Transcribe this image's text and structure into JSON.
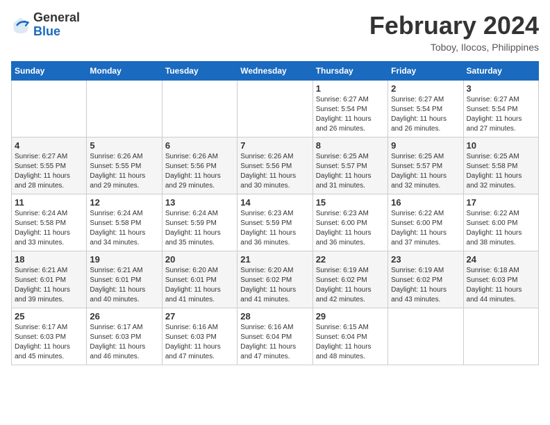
{
  "header": {
    "logo_general": "General",
    "logo_blue": "Blue",
    "title": "February 2024",
    "subtitle": "Toboy, Ilocos, Philippines"
  },
  "weekdays": [
    "Sunday",
    "Monday",
    "Tuesday",
    "Wednesday",
    "Thursday",
    "Friday",
    "Saturday"
  ],
  "weeks": [
    [
      {
        "day": "",
        "info": ""
      },
      {
        "day": "",
        "info": ""
      },
      {
        "day": "",
        "info": ""
      },
      {
        "day": "",
        "info": ""
      },
      {
        "day": "1",
        "info": "Sunrise: 6:27 AM\nSunset: 5:54 PM\nDaylight: 11 hours\nand 26 minutes."
      },
      {
        "day": "2",
        "info": "Sunrise: 6:27 AM\nSunset: 5:54 PM\nDaylight: 11 hours\nand 26 minutes."
      },
      {
        "day": "3",
        "info": "Sunrise: 6:27 AM\nSunset: 5:54 PM\nDaylight: 11 hours\nand 27 minutes."
      }
    ],
    [
      {
        "day": "4",
        "info": "Sunrise: 6:27 AM\nSunset: 5:55 PM\nDaylight: 11 hours\nand 28 minutes."
      },
      {
        "day": "5",
        "info": "Sunrise: 6:26 AM\nSunset: 5:55 PM\nDaylight: 11 hours\nand 29 minutes."
      },
      {
        "day": "6",
        "info": "Sunrise: 6:26 AM\nSunset: 5:56 PM\nDaylight: 11 hours\nand 29 minutes."
      },
      {
        "day": "7",
        "info": "Sunrise: 6:26 AM\nSunset: 5:56 PM\nDaylight: 11 hours\nand 30 minutes."
      },
      {
        "day": "8",
        "info": "Sunrise: 6:25 AM\nSunset: 5:57 PM\nDaylight: 11 hours\nand 31 minutes."
      },
      {
        "day": "9",
        "info": "Sunrise: 6:25 AM\nSunset: 5:57 PM\nDaylight: 11 hours\nand 32 minutes."
      },
      {
        "day": "10",
        "info": "Sunrise: 6:25 AM\nSunset: 5:58 PM\nDaylight: 11 hours\nand 32 minutes."
      }
    ],
    [
      {
        "day": "11",
        "info": "Sunrise: 6:24 AM\nSunset: 5:58 PM\nDaylight: 11 hours\nand 33 minutes."
      },
      {
        "day": "12",
        "info": "Sunrise: 6:24 AM\nSunset: 5:58 PM\nDaylight: 11 hours\nand 34 minutes."
      },
      {
        "day": "13",
        "info": "Sunrise: 6:24 AM\nSunset: 5:59 PM\nDaylight: 11 hours\nand 35 minutes."
      },
      {
        "day": "14",
        "info": "Sunrise: 6:23 AM\nSunset: 5:59 PM\nDaylight: 11 hours\nand 36 minutes."
      },
      {
        "day": "15",
        "info": "Sunrise: 6:23 AM\nSunset: 6:00 PM\nDaylight: 11 hours\nand 36 minutes."
      },
      {
        "day": "16",
        "info": "Sunrise: 6:22 AM\nSunset: 6:00 PM\nDaylight: 11 hours\nand 37 minutes."
      },
      {
        "day": "17",
        "info": "Sunrise: 6:22 AM\nSunset: 6:00 PM\nDaylight: 11 hours\nand 38 minutes."
      }
    ],
    [
      {
        "day": "18",
        "info": "Sunrise: 6:21 AM\nSunset: 6:01 PM\nDaylight: 11 hours\nand 39 minutes."
      },
      {
        "day": "19",
        "info": "Sunrise: 6:21 AM\nSunset: 6:01 PM\nDaylight: 11 hours\nand 40 minutes."
      },
      {
        "day": "20",
        "info": "Sunrise: 6:20 AM\nSunset: 6:01 PM\nDaylight: 11 hours\nand 41 minutes."
      },
      {
        "day": "21",
        "info": "Sunrise: 6:20 AM\nSunset: 6:02 PM\nDaylight: 11 hours\nand 41 minutes."
      },
      {
        "day": "22",
        "info": "Sunrise: 6:19 AM\nSunset: 6:02 PM\nDaylight: 11 hours\nand 42 minutes."
      },
      {
        "day": "23",
        "info": "Sunrise: 6:19 AM\nSunset: 6:02 PM\nDaylight: 11 hours\nand 43 minutes."
      },
      {
        "day": "24",
        "info": "Sunrise: 6:18 AM\nSunset: 6:03 PM\nDaylight: 11 hours\nand 44 minutes."
      }
    ],
    [
      {
        "day": "25",
        "info": "Sunrise: 6:17 AM\nSunset: 6:03 PM\nDaylight: 11 hours\nand 45 minutes."
      },
      {
        "day": "26",
        "info": "Sunrise: 6:17 AM\nSunset: 6:03 PM\nDaylight: 11 hours\nand 46 minutes."
      },
      {
        "day": "27",
        "info": "Sunrise: 6:16 AM\nSunset: 6:03 PM\nDaylight: 11 hours\nand 47 minutes."
      },
      {
        "day": "28",
        "info": "Sunrise: 6:16 AM\nSunset: 6:04 PM\nDaylight: 11 hours\nand 47 minutes."
      },
      {
        "day": "29",
        "info": "Sunrise: 6:15 AM\nSunset: 6:04 PM\nDaylight: 11 hours\nand 48 minutes."
      },
      {
        "day": "",
        "info": ""
      },
      {
        "day": "",
        "info": ""
      }
    ]
  ]
}
